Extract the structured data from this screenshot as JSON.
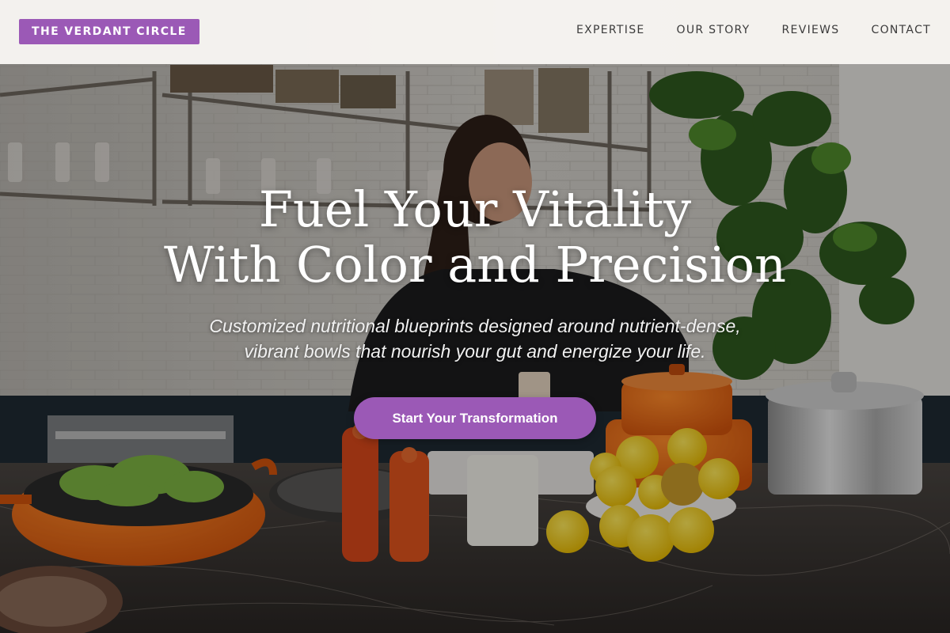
{
  "brand": {
    "name": "THE VERDANT CIRCLE",
    "accent_color": "#9b59b6"
  },
  "nav": {
    "items": [
      {
        "label": "EXPERTISE"
      },
      {
        "label": "OUR STORY"
      },
      {
        "label": "REVIEWS"
      },
      {
        "label": "CONTACT"
      }
    ]
  },
  "hero": {
    "headline_line1": "Fuel Your Vitality",
    "headline_line2": "With Color and Precision",
    "subtext": "Customized nutritional blueprints designed around nutrient-dense, vibrant bowls that nourish your gut and energize your life.",
    "cta_label": "Start Your Transformation",
    "background_image": "kitchen-scene-woman-cooking-with-orange-pots-and-lemons"
  }
}
